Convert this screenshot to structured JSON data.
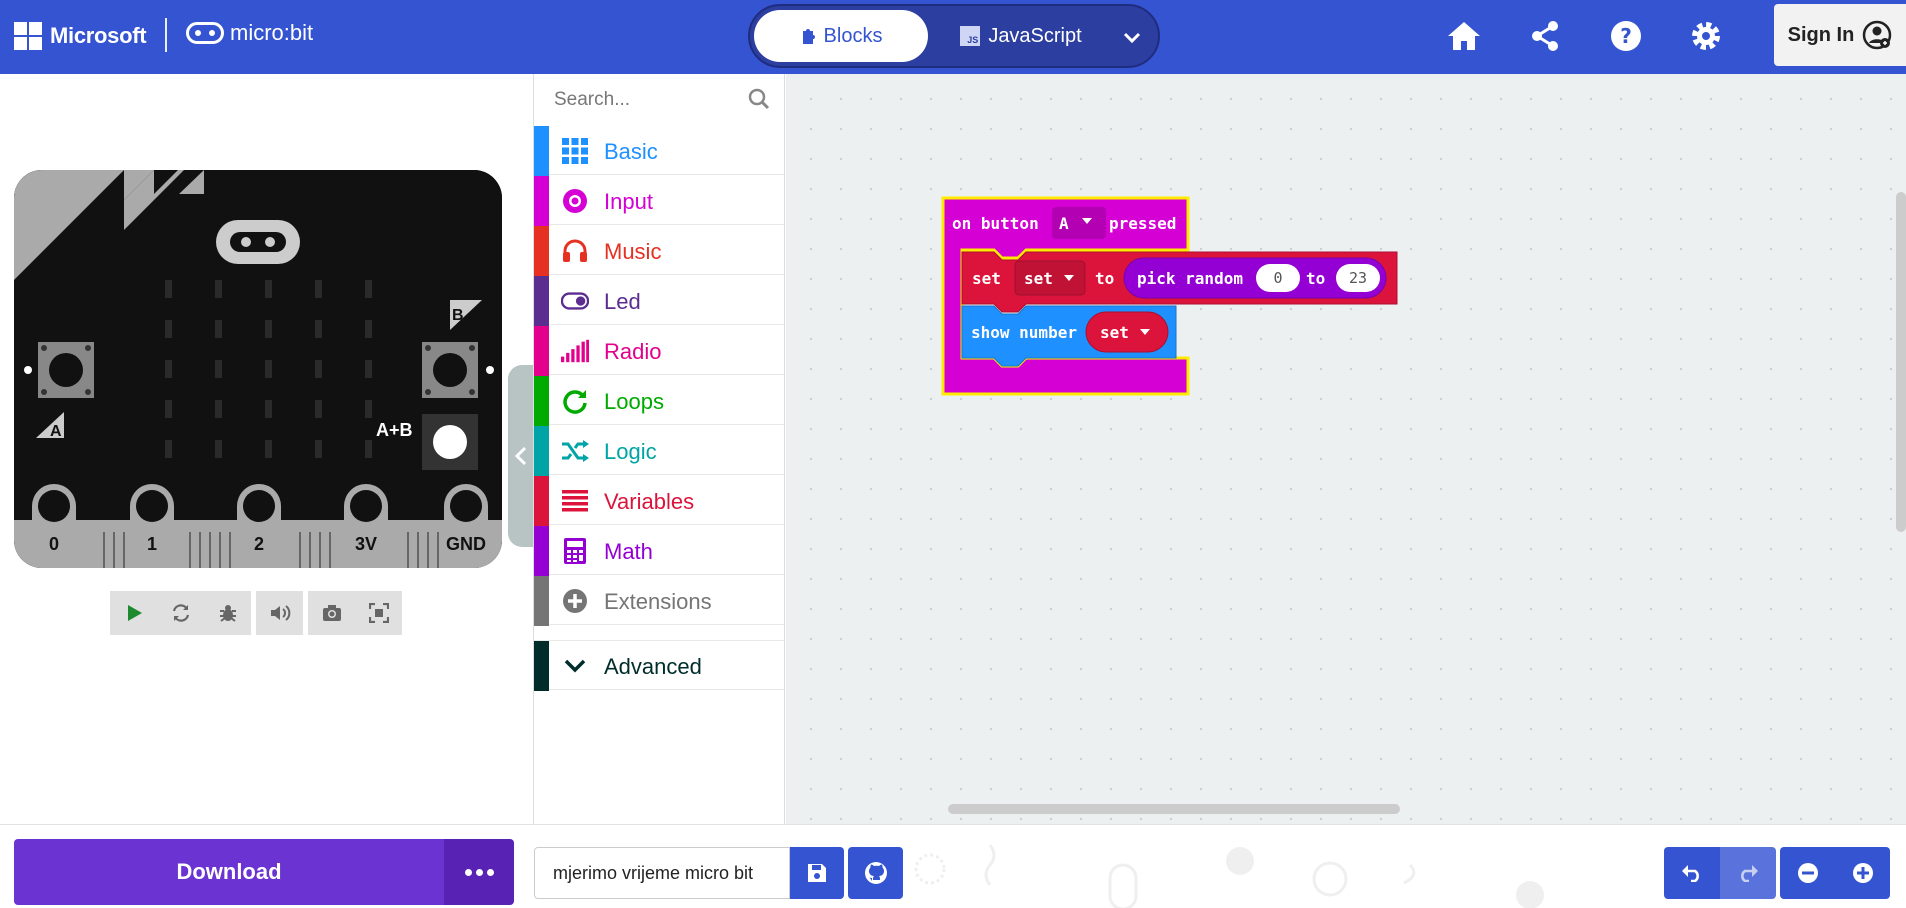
{
  "header": {
    "brand": "Microsoft",
    "product": "micro:bit",
    "tabs": [
      {
        "label": "Blocks"
      },
      {
        "label": "JavaScript"
      }
    ],
    "js_badge": "JS",
    "sign_in": "Sign In",
    "accent_color": "#3454d1"
  },
  "simulator": {
    "pins": [
      "0",
      "1",
      "2",
      "3V",
      "GND"
    ],
    "buttons": {
      "a": "A",
      "b": "B",
      "ab": "A+B"
    },
    "toolbar_icons": [
      "play-icon",
      "restart-icon",
      "debug-icon",
      "mute-icon",
      "screenshot-icon",
      "fullscreen-icon"
    ]
  },
  "toolbox": {
    "search_placeholder": "Search...",
    "categories": [
      {
        "label": "Basic",
        "color": "#1e90ff"
      },
      {
        "label": "Input",
        "color": "#d400d4"
      },
      {
        "label": "Music",
        "color": "#e63022"
      },
      {
        "label": "Led",
        "color": "#5c2d91"
      },
      {
        "label": "Radio",
        "color": "#e3008c"
      },
      {
        "label": "Loops",
        "color": "#00aa00"
      },
      {
        "label": "Logic",
        "color": "#00a4a6"
      },
      {
        "label": "Variables",
        "color": "#dc143c"
      },
      {
        "label": "Math",
        "color": "#9400d3"
      },
      {
        "label": "Extensions",
        "color": "#757575"
      }
    ],
    "advanced": {
      "label": "Advanced",
      "color": "#002d2c"
    }
  },
  "workspace": {
    "event_block": {
      "prefix": "on button",
      "button": "A",
      "suffix": "pressed"
    },
    "set_block": {
      "label": "set",
      "variable": "set",
      "to": "to",
      "random_label": "pick random",
      "from": "0",
      "to_kw": "to",
      "max": "23"
    },
    "show_block": {
      "label": "show number",
      "variable": "set"
    }
  },
  "bottom": {
    "download": "Download",
    "project_name": "mjerimo vrijeme micro bit"
  }
}
